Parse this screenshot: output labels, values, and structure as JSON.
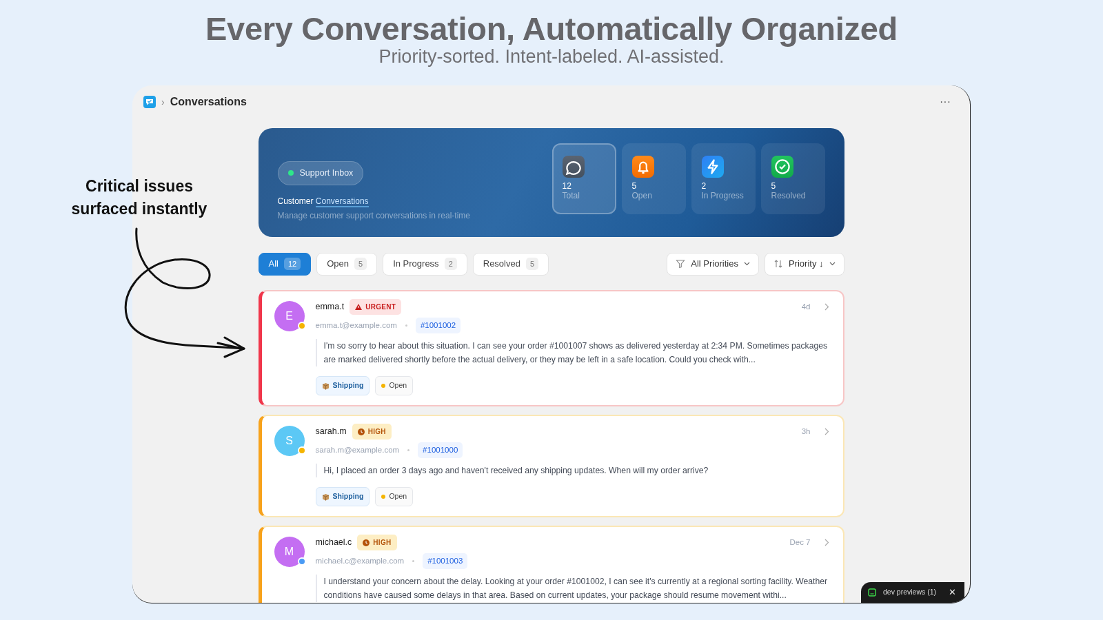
{
  "headline": {
    "title": "Every Conversation, Automatically Organized",
    "subtitle": "Priority-sorted. Intent-labeled. AI-assisted."
  },
  "annotation": {
    "text": "Critical issues surfaced instantly"
  },
  "window": {
    "separator": "›",
    "title": "Conversations",
    "menu": "···"
  },
  "hero": {
    "badge": "Support Inbox",
    "heading_plain": "Customer",
    "heading_highlight": "Conversations",
    "description": "Manage customer support conversations in real-time",
    "stats": [
      {
        "kind": "total",
        "value": "12",
        "label": "Total",
        "selected": true
      },
      {
        "kind": "open",
        "value": "5",
        "label": "Open",
        "selected": false
      },
      {
        "kind": "progress",
        "value": "2",
        "label": "In Progress",
        "selected": false
      },
      {
        "kind": "resolved",
        "value": "5",
        "label": "Resolved",
        "selected": false
      }
    ]
  },
  "filters": {
    "tabs": [
      {
        "label": "All",
        "count": "12",
        "selected": true
      },
      {
        "label": "Open",
        "count": "5",
        "selected": false
      },
      {
        "label": "In Progress",
        "count": "2",
        "selected": false
      },
      {
        "label": "Resolved",
        "count": "5",
        "selected": false
      }
    ],
    "priority_filter": "All Priorities",
    "sort": "Priority ↓"
  },
  "conversations": [
    {
      "initial": "E",
      "color": "#c46ef2",
      "online": false,
      "name": "emma.t",
      "priority": "URGENT",
      "kind": "urgent",
      "email": "emma.t@example.com",
      "order": "#1001002",
      "time": "4d",
      "message": "I'm so sorry to hear about this situation. I can see your order #1001007 shows as delivered yesterday at 2:34 PM. Sometimes packages are marked delivered shortly before the actual delivery, or they may be left in a safe location. Could you check with...",
      "tags": [
        {
          "kind": "intent",
          "label": "Shipping"
        },
        {
          "kind": "status",
          "label": "Open"
        }
      ]
    },
    {
      "initial": "S",
      "color": "#5cc8f5",
      "online": false,
      "name": "sarah.m",
      "priority": "HIGH",
      "kind": "high",
      "email": "sarah.m@example.com",
      "order": "#1001000",
      "time": "3h",
      "message": "Hi, I placed an order 3 days ago and haven't received any shipping updates. When will my order arrive?",
      "tags": [
        {
          "kind": "intent",
          "label": "Shipping"
        },
        {
          "kind": "status",
          "label": "Open"
        }
      ]
    },
    {
      "initial": "M",
      "color": "#c46ef2",
      "online": true,
      "name": "michael.c",
      "priority": "HIGH",
      "kind": "high",
      "email": "michael.c@example.com",
      "order": "#1001003",
      "time": "Dec 7",
      "message": "I understand your concern about the delay. Looking at your order #1001002, I can see it's currently at a regional sorting facility. Weather conditions have caused some delays in that area. Based on current updates, your package should resume movement withi..."
    }
  ],
  "dev_bar": {
    "label": "dev previews",
    "count": "(1)",
    "close": "✕"
  }
}
